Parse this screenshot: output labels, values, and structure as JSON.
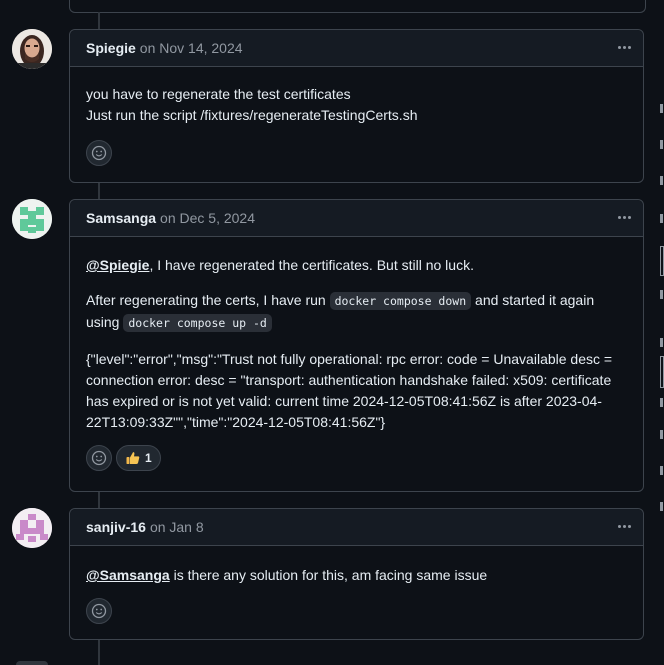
{
  "comments": [
    {
      "author": "Spiegie",
      "date": "on Nov 14, 2024",
      "lines": [
        "you have to regenerate the test certificates",
        "Just run the script /fixtures/regenerateTestingCerts.sh"
      ]
    },
    {
      "author": "Samsanga",
      "date": "on Dec 5, 2024",
      "p1_mention": "@Spiegie",
      "p1_text": ", I have regenerated the certificates. But still no luck.",
      "p2_a": "After regenerating the certs, I have run ",
      "p2_code1": "docker compose down",
      "p2_b": " and started it again using ",
      "p2_code2": "docker compose up -d",
      "log": "{\"level\":\"error\",\"msg\":\"Trust not fully operational: rpc error: code = Unavailable desc = connection error: desc = \"transport: authentication handshake failed: x509: certificate has expired or is not yet valid: current time 2024-12-05T08:41:56Z is after 2023-04-22T13:09:33Z\"\",\"time\":\"2024-12-05T08:41:56Z\"}",
      "reaction_count": "1"
    },
    {
      "author": "sanjiv-16",
      "date": "on Jan 8",
      "mention": "@Samsanga",
      "text": " is there any solution for this, am facing same issue"
    }
  ],
  "icons": {
    "reaction_add": "smiley-icon",
    "reaction_thumbs": "thumbs-up-icon",
    "menu": "kebab-horizontal-icon"
  },
  "colors": {
    "background": "#0d1117",
    "header_bg": "#151b23",
    "border": "#3d444d",
    "muted_text": "#9198a1",
    "avatar_samsanga": "#5fc99a",
    "avatar_sanjiv": "#c98ac9"
  }
}
